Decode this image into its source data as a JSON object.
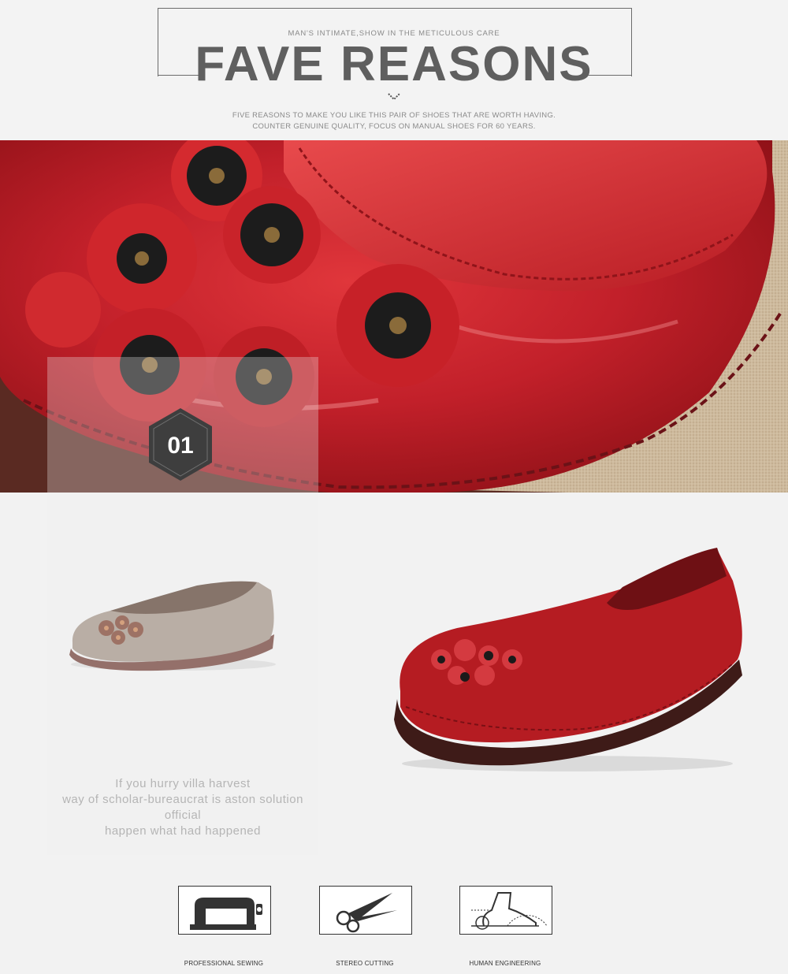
{
  "header": {
    "tagline": "MAN'S INTIMATE,SHOW IN THE METICULOUS CARE",
    "title": "FAVE REASONS",
    "subtitle_line1": "FIVE REASONS TO MAKE YOU LIKE THIS PAIR OF SHOES THAT ARE WORTH HAVING.",
    "subtitle_line2": "COUNTER GENUINE QUALITY, FOCUS ON MANUAL SHOES FOR 60 YEARS."
  },
  "section": {
    "badge_number": "01",
    "caption_lines": [
      "If you hurry villa harvest",
      "way of scholar-bureaucrat is aston solution",
      "official",
      "happen what had happened"
    ]
  },
  "features": [
    {
      "label": "PROFESSIONAL SEWING",
      "icon": "sewing-machine-icon"
    },
    {
      "label": "STEREO CUTTING",
      "icon": "scissors-icon"
    },
    {
      "label": "HUMAN ENGINEERING",
      "icon": "foot-ergonomics-icon"
    }
  ],
  "colors": {
    "title": "#5f5f5f",
    "shoe_red": "#b51c22",
    "shoe_taupe": "#a39286",
    "badge": "#3e3e3e"
  }
}
